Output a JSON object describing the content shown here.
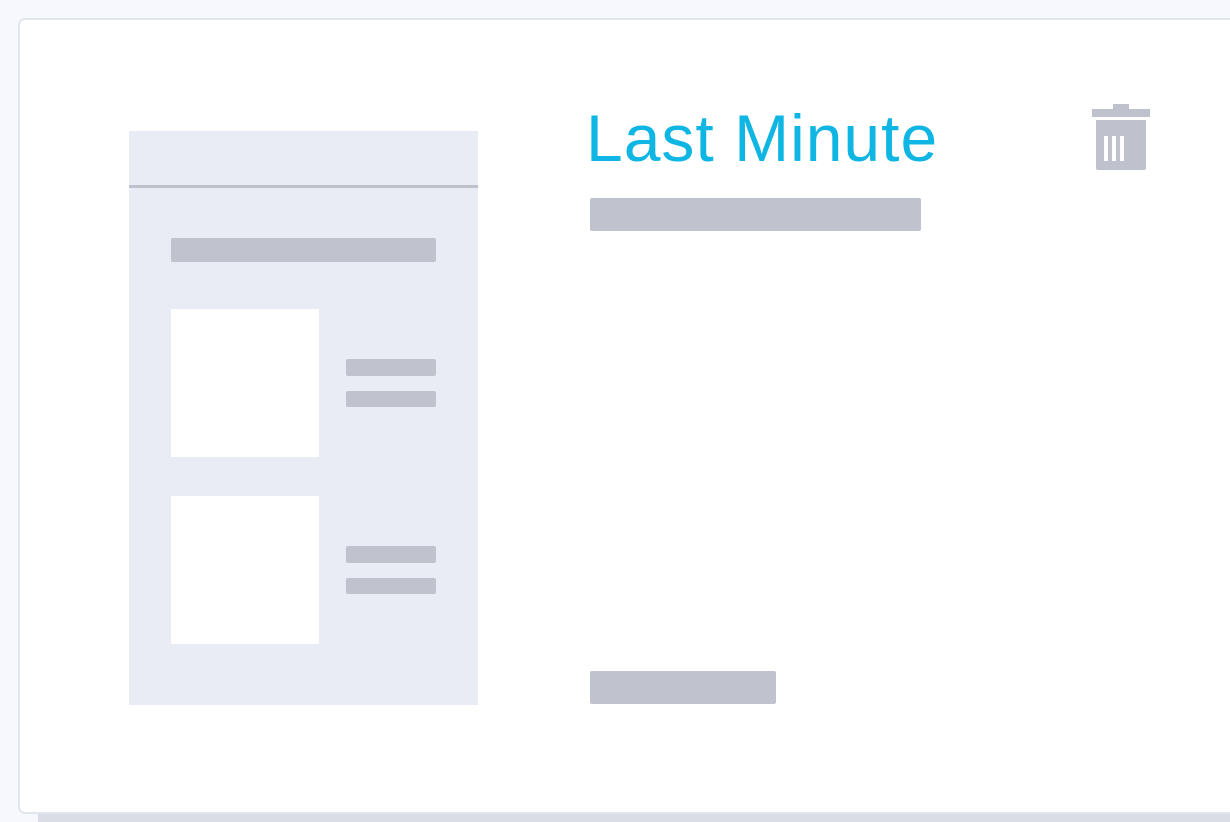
{
  "template": {
    "title": "Last Minute",
    "title_color": "#0fb6e3",
    "delete_icon": "trash-icon"
  },
  "colors": {
    "placeholder_bar": "#c0c2cd",
    "preview_background": "#eaecf5",
    "icon": "#bfc2cd"
  }
}
